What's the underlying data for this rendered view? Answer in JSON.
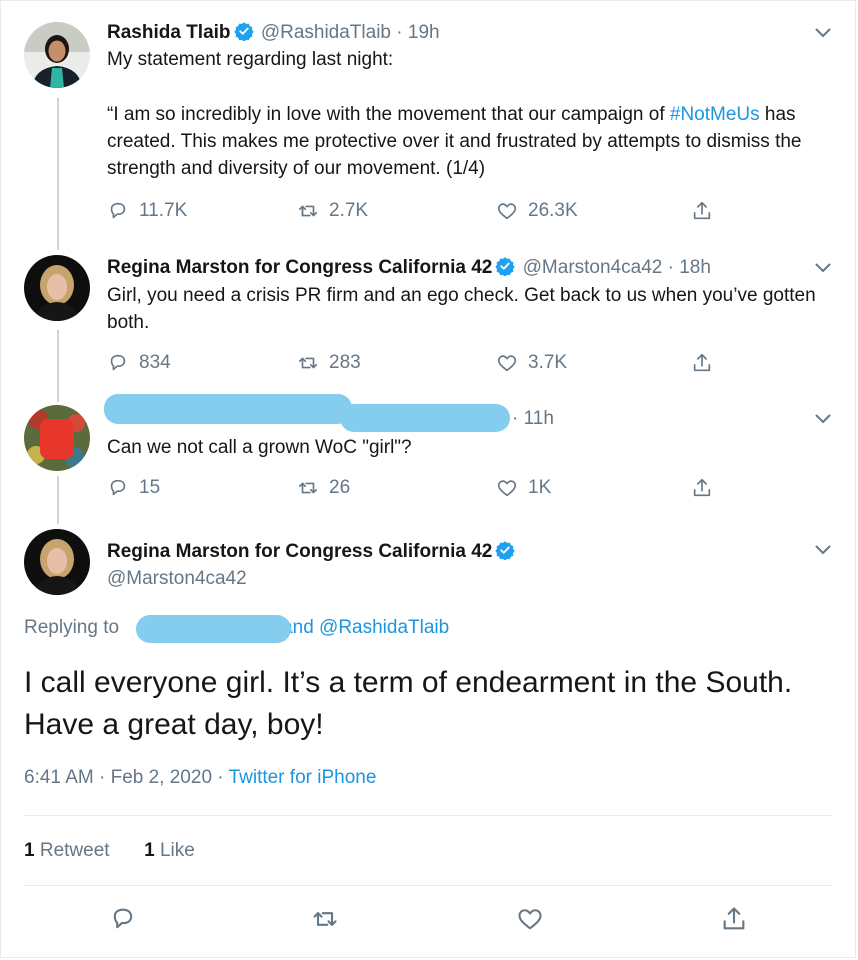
{
  "colors": {
    "accent": "#1b95e0",
    "muted": "#657786",
    "text": "#14171a",
    "redaction": "#84cdef"
  },
  "tweets": [
    {
      "name": "Rashida Tlaib",
      "handle": "@RashidaTlaib",
      "dot": "·",
      "time": "19h",
      "text_lines": [
        "My statement regarding last night:"
      ],
      "quote_pre": "“I am so incredibly in love with the movement that our campaign of ",
      "hashtag": "#NotMeUs",
      "quote_post": " has created. This makes me protective over it and frustrated by attempts to dismiss the strength and diversity of our movement. (1/4)",
      "replies": "11.7K",
      "retweets": "2.7K",
      "likes": "26.3K"
    },
    {
      "name": "Regina Marston for Congress California 42",
      "handle": "@Marston4ca42",
      "dot": "·",
      "time": "18h",
      "text": "Girl, you need a crisis PR firm and an ego check. Get back to us when you’ve gotten both.",
      "replies": "834",
      "retweets": "283",
      "likes": "3.7K"
    },
    {
      "dot": "·",
      "time": "11h",
      "text": "Can we not call a grown WoC \"girl\"?",
      "replies": "15",
      "retweets": "26",
      "likes": "1K"
    }
  ],
  "main_tweet": {
    "name": "Regina Marston for Congress California 42",
    "handle": "@Marston4ca42",
    "replying_label": "Replying to",
    "replying_and": "and @RashidaTlaib",
    "text": "I call everyone girl. It’s a term of endearment in the South. Have a great day, boy!",
    "timestamp": "6:41 AM · Feb 2, 2020 ·",
    "source": "Twitter for iPhone",
    "retweet_count": "1",
    "retweet_label": "Retweet",
    "like_count": "1",
    "like_label": "Like"
  },
  "icons": [
    "verified-badge-icon",
    "chevron-down-icon",
    "reply-icon",
    "retweet-icon",
    "like-icon",
    "share-icon"
  ]
}
